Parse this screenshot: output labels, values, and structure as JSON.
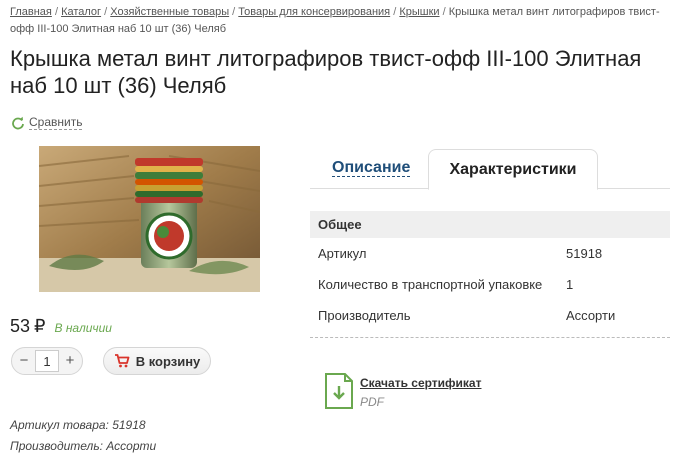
{
  "breadcrumb": {
    "items": [
      "Главная",
      "Каталог",
      "Хозяйственные товары",
      "Товары для консервирования",
      "Крышки"
    ],
    "current": "Крышка метал винт литографиров твист-офф III-100 Элитная наб 10 шт (36) Челяб",
    "separator": "/"
  },
  "product": {
    "title": "Крышка метал винт литографиров твист-офф III-100 Элитная наб 10 шт (36) Челяб",
    "compare_label": "Сравнить",
    "price": "53",
    "currency": "₽",
    "stock": "В наличии",
    "quantity": "1",
    "add_to_cart": "В корзину",
    "article_line": "Артикул товара: 51918",
    "manufacturer_line": "Производитель: Ассорти"
  },
  "tabs": {
    "description": "Описание",
    "characteristics": "Характеристики"
  },
  "specs": {
    "group": "Общее",
    "rows": [
      {
        "key": "Артикул",
        "value": "51918"
      },
      {
        "key": "Количество в транспортной упаковке",
        "value": "1"
      },
      {
        "key": "Производитель",
        "value": "Ассорти"
      }
    ]
  },
  "certificate": {
    "link": "Скачать сертификат",
    "format": "PDF"
  },
  "colors": {
    "accent_green": "#6aa84f",
    "tab_link": "#1f4e79",
    "cart_red": "#d9342b"
  }
}
